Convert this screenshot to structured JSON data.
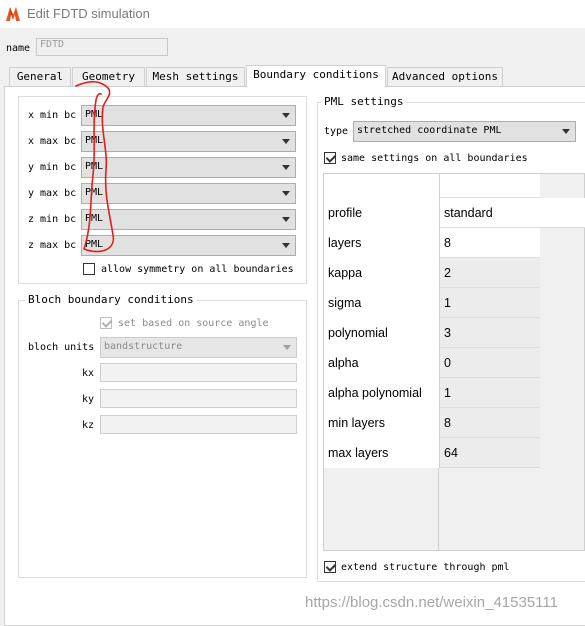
{
  "window": {
    "title": "Edit FDTD simulation",
    "icon": "lumerical-logo"
  },
  "name_field": {
    "label": "name",
    "value": "FDTD"
  },
  "tabs": [
    {
      "label": "General",
      "active": false
    },
    {
      "label": "Geometry",
      "active": false
    },
    {
      "label": "Mesh settings",
      "active": false
    },
    {
      "label": "Boundary conditions",
      "active": true
    },
    {
      "label": "Advanced options",
      "active": false
    }
  ],
  "boundaries": [
    {
      "label": "x min bc",
      "value": "PML"
    },
    {
      "label": "x max bc",
      "value": "PML"
    },
    {
      "label": "y min bc",
      "value": "PML"
    },
    {
      "label": "y max bc",
      "value": "PML"
    },
    {
      "label": "z min bc",
      "value": "PML"
    },
    {
      "label": "z max bc",
      "value": "PML"
    }
  ],
  "allow_symmetry": {
    "label": "allow symmetry on all boundaries",
    "checked": false
  },
  "bloch": {
    "title": "Bloch boundary conditions",
    "set_based": {
      "label": "set based on source angle",
      "checked": true,
      "enabled": false
    },
    "units_label": "bloch units",
    "units_value": "bandstructure",
    "kx_label": "kx",
    "ky_label": "ky",
    "kz_label": "kz"
  },
  "pml": {
    "title": "PML settings",
    "type_label": "type",
    "type_value": "stretched coordinate PML",
    "same_settings": {
      "label": "same settings on all boundaries",
      "checked": true
    },
    "rows": [
      {
        "key": "profile",
        "value": "standard"
      },
      {
        "key": "layers",
        "value": "8"
      },
      {
        "key": "kappa",
        "value": "2"
      },
      {
        "key": "sigma",
        "value": "1"
      },
      {
        "key": "polynomial",
        "value": "3"
      },
      {
        "key": "alpha",
        "value": "0"
      },
      {
        "key": "alpha polynomial",
        "value": "1"
      },
      {
        "key": "min layers",
        "value": "8"
      },
      {
        "key": "max layers",
        "value": "64"
      }
    ],
    "extend": {
      "label": "extend structure through pml",
      "checked": true
    }
  },
  "watermark": "https://blog.csdn.net/weixin_41535111",
  "colors": {
    "annotation": "#e0201a",
    "logo_orange": "#e8551c"
  }
}
